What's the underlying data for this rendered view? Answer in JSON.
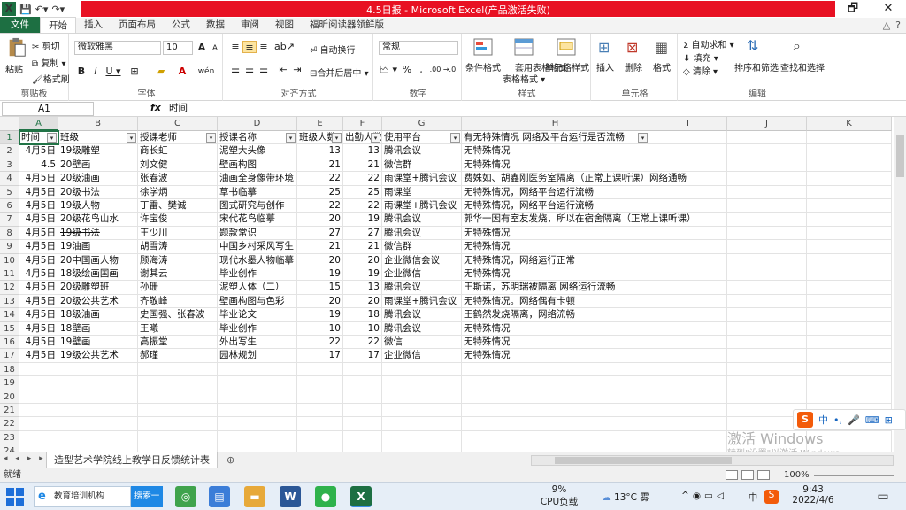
{
  "window": {
    "title": "4.5日报 - Microsoft Excel(产品激活失败)",
    "controls": [
      "🗗",
      "✕"
    ]
  },
  "ribbon_tabs": [
    "文件",
    "开始",
    "插入",
    "页面布局",
    "公式",
    "数据",
    "审阅",
    "视图",
    "福昕阅读器领鲜版"
  ],
  "ribbon": {
    "clipboard": {
      "label": "剪贴板",
      "paste": "粘贴",
      "cut": "剪切",
      "copy": "复制 ▾",
      "format_painter": "格式刷"
    },
    "font": {
      "label": "字体",
      "font_name": "微软雅黑",
      "font_size": "10",
      "grow": "A",
      "shrink": "A",
      "bold": "B",
      "italic": "I",
      "underline": "U ▾",
      "phonetic": "wén"
    },
    "alignment": {
      "label": "对齐方式",
      "wrap": "自动换行",
      "merge": "合并后居中 ▾"
    },
    "number": {
      "label": "数字",
      "format": "常规",
      "percent": "%",
      "comma": ",",
      "currency": "🗠 ▾",
      "inc_decimal": ".00",
      "dec_decimal": "→.0"
    },
    "styles": {
      "label": "样式",
      "conditional": "条件格式",
      "table_format": "套用表格格式",
      "table_format_l2": "表格格式 ▾",
      "cell_styles": "单元格样式"
    },
    "cells": {
      "label": "单元格",
      "insert": "插入",
      "delete": "删除",
      "format": "格式"
    },
    "editing": {
      "label": "编辑",
      "autosum": "Σ 自动求和 ▾",
      "fill": "填充 ▾",
      "clear": "清除 ▾",
      "sort_filter": "排序和筛选",
      "find_select": "查找和选择"
    }
  },
  "formula_bar": {
    "name_box": "A1",
    "fx": "fx",
    "content": "时间"
  },
  "columns": [
    {
      "id": "A",
      "w": 44
    },
    {
      "id": "B",
      "w": 90
    },
    {
      "id": "C",
      "w": 90
    },
    {
      "id": "D",
      "w": 90
    },
    {
      "id": "E",
      "w": 52
    },
    {
      "id": "F",
      "w": 44
    },
    {
      "id": "G",
      "w": 90
    },
    {
      "id": "H",
      "w": 212
    },
    {
      "id": "I",
      "w": 88
    },
    {
      "id": "J",
      "w": 90
    },
    {
      "id": "K",
      "w": 96
    }
  ],
  "headers": [
    "时间",
    "班级",
    "授课老师",
    "授课名称",
    "班级人数",
    "出勤人数",
    "使用平台",
    "有无特殊情况 网络及平台运行是否流畅"
  ],
  "rows": [
    [
      "4月5日",
      "19级雕塑",
      "商长虹",
      "泥塑大头像",
      "13",
      "13",
      "腾讯会议",
      "无特殊情况"
    ],
    [
      "4.5",
      "20壁画",
      "刘文健",
      "壁画构图",
      "21",
      "21",
      "微信群",
      "无特殊情况"
    ],
    [
      "4月5日",
      "20级油画",
      "张春波",
      "油画全身像带环境",
      "22",
      "22",
      "雨课堂+腾讯会议",
      "费姝如、胡鑫刚医务室隔离（正常上课听课）网络通畅"
    ],
    [
      "4月5日",
      "20级书法",
      "徐学炳",
      "草书临摹",
      "25",
      "25",
      "雨课堂",
      "无特殊情况，网络平台运行流畅"
    ],
    [
      "4月5日",
      "19级人物",
      "丁雷、樊诚",
      "图式研究与创作",
      "22",
      "22",
      "雨课堂+腾讯会议",
      "无特殊情况，网络平台运行流畅"
    ],
    [
      "4月5日",
      "20级花鸟山水",
      "许宝俊",
      "宋代花鸟临摹",
      "20",
      "19",
      "腾讯会议",
      "郭华一因有室友发烧，所以在宿舍隔离（正常上课听课）"
    ],
    [
      "4月5日",
      "19级书法",
      "王少川",
      "题款常识",
      "27",
      "27",
      "腾讯会议",
      "无特殊情况"
    ],
    [
      "4月5日",
      "19油画",
      "胡雪涛",
      "中国乡村采风写生",
      "21",
      "21",
      "微信群",
      "无特殊情况"
    ],
    [
      "4月5日",
      "20中国画人物",
      "顾海涛",
      "现代水墨人物临摹",
      "20",
      "20",
      "企业微信会议",
      "无特殊情况，网络运行正常"
    ],
    [
      "4月5日",
      "18级绘画国画",
      "谢其云",
      "毕业创作",
      "19",
      "19",
      "企业微信",
      "无特殊情况"
    ],
    [
      "4月5日",
      "20级雕塑班",
      "孙珊",
      "泥塑人体（二）",
      "15",
      "13",
      "腾讯会议",
      "王斯诺，苏明瑞被隔离 网络运行流畅"
    ],
    [
      "4月5日",
      "20级公共艺术",
      "齐敬峰",
      "壁画构图与色彩",
      "20",
      "20",
      "雨课堂+腾讯会议",
      "无特殊情况。网络偶有卡顿"
    ],
    [
      "4月5日",
      "18级油画",
      "史国强、张春波",
      "毕业论文",
      "19",
      "18",
      "腾讯会议",
      "王鹤然发烧隔离，网络流畅"
    ],
    [
      "4月5日",
      "18壁画",
      "王曦",
      "毕业创作",
      "10",
      "10",
      "腾讯会议",
      "无特殊情况"
    ],
    [
      "4月5日",
      "19壁画",
      "高振堂",
      "外出写生",
      "22",
      "22",
      "微信",
      "无特殊情况"
    ],
    [
      "4月5日",
      "19级公共艺术",
      "郝瑾",
      "园林规划",
      "17",
      "17",
      "企业微信",
      "无特殊情况"
    ]
  ],
  "total_visible_rows": 24,
  "sheet": {
    "name": "造型艺术学院线上教学日反馈统计表",
    "nav": "◂ ◂ ▸ ▸"
  },
  "status": {
    "ready": "就绪",
    "zoom": "100%"
  },
  "watermark": {
    "line1": "激活 Windows",
    "line2": "转到\"设置\"以激活 Windows。"
  },
  "ime": {
    "items": [
      "S",
      "中",
      "•,",
      "🎤",
      "⌨",
      "⊞"
    ]
  },
  "taskbar": {
    "ie_label": "教育培训机构",
    "search_label": "搜索一下",
    "cpu_pct": "9%",
    "cpu_label": "CPU负载",
    "weather": "13°C 雾",
    "ime_mode": "中",
    "time": "9:43",
    "date": "2022/4/6"
  },
  "colors": {
    "excel_green": "#217346",
    "title_red": "#e81123",
    "accent": "#1d6f42"
  }
}
